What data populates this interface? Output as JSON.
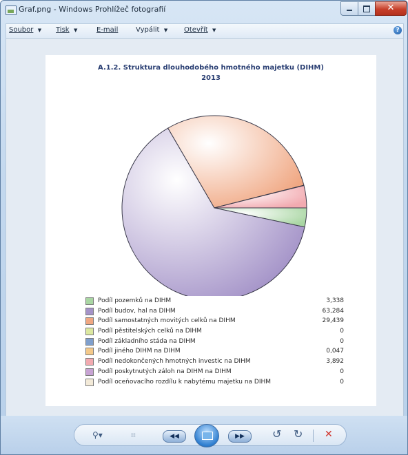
{
  "window": {
    "title": "Graf.png - Windows Prohlížeč fotografií",
    "close_glyph": "✕"
  },
  "menu": {
    "items": [
      {
        "label": "Soubor",
        "key": "S"
      },
      {
        "label": "Tisk",
        "key": "T"
      },
      {
        "label": "E-mail",
        "key": "E"
      },
      {
        "label": "Vypálit",
        "key": "p"
      },
      {
        "label": "Otevřít",
        "key": "O"
      }
    ],
    "arrow": "▼",
    "help_glyph": "?"
  },
  "chart_data": {
    "type": "pie",
    "title": "A.1.2. Struktura dlouhodobého hmotného majetku (DIHM)",
    "subtitle": "2013",
    "legend_placement": "bottom",
    "series": [
      {
        "name": "Podíl pozemků na DIHM",
        "value_text": "3,338",
        "value": 3.338,
        "color": "#a9d6a3"
      },
      {
        "name": "Podíl budov, hal na DIHM",
        "value_text": "63,284",
        "value": 63.284,
        "color": "#a493c8"
      },
      {
        "name": "Podíl samostatných movitých celků na DIHM",
        "value_text": "29,439",
        "value": 29.439,
        "color": "#f0a782"
      },
      {
        "name": "Podíl pěstitelských celků na DIHM",
        "value_text": "0",
        "value": 0,
        "color": "#dce8a0"
      },
      {
        "name": "Podíl základního stáda na DIHM",
        "value_text": "0",
        "value": 0,
        "color": "#7f9fcc"
      },
      {
        "name": "Podíl jiného DIHM na DIHM",
        "value_text": "0,047",
        "value": 0.047,
        "color": "#f4c98a"
      },
      {
        "name": "Podíl nedokončených hmotných investic na DIHM",
        "value_text": "3,892",
        "value": 3.892,
        "color": "#f2aab0"
      },
      {
        "name": "Podíl poskytnutých záloh na DIHM na DIHM",
        "value_text": "0",
        "value": 0,
        "color": "#c7a3d3"
      },
      {
        "name": "Podíl oceňovacího rozdílu k nabytému majetku na DIHM",
        "value_text": "0",
        "value": 0,
        "color": "#f3ead8"
      }
    ]
  },
  "toolbar": {
    "zoom_glyph": "⚲▾",
    "fit_glyph": "⌗",
    "prev_glyph": "◀◀",
    "next_glyph": "▶▶",
    "rotate_ccw_glyph": "↺",
    "rotate_cw_glyph": "↻",
    "delete_glyph": "✕",
    "delete_color": "#d0332a"
  }
}
